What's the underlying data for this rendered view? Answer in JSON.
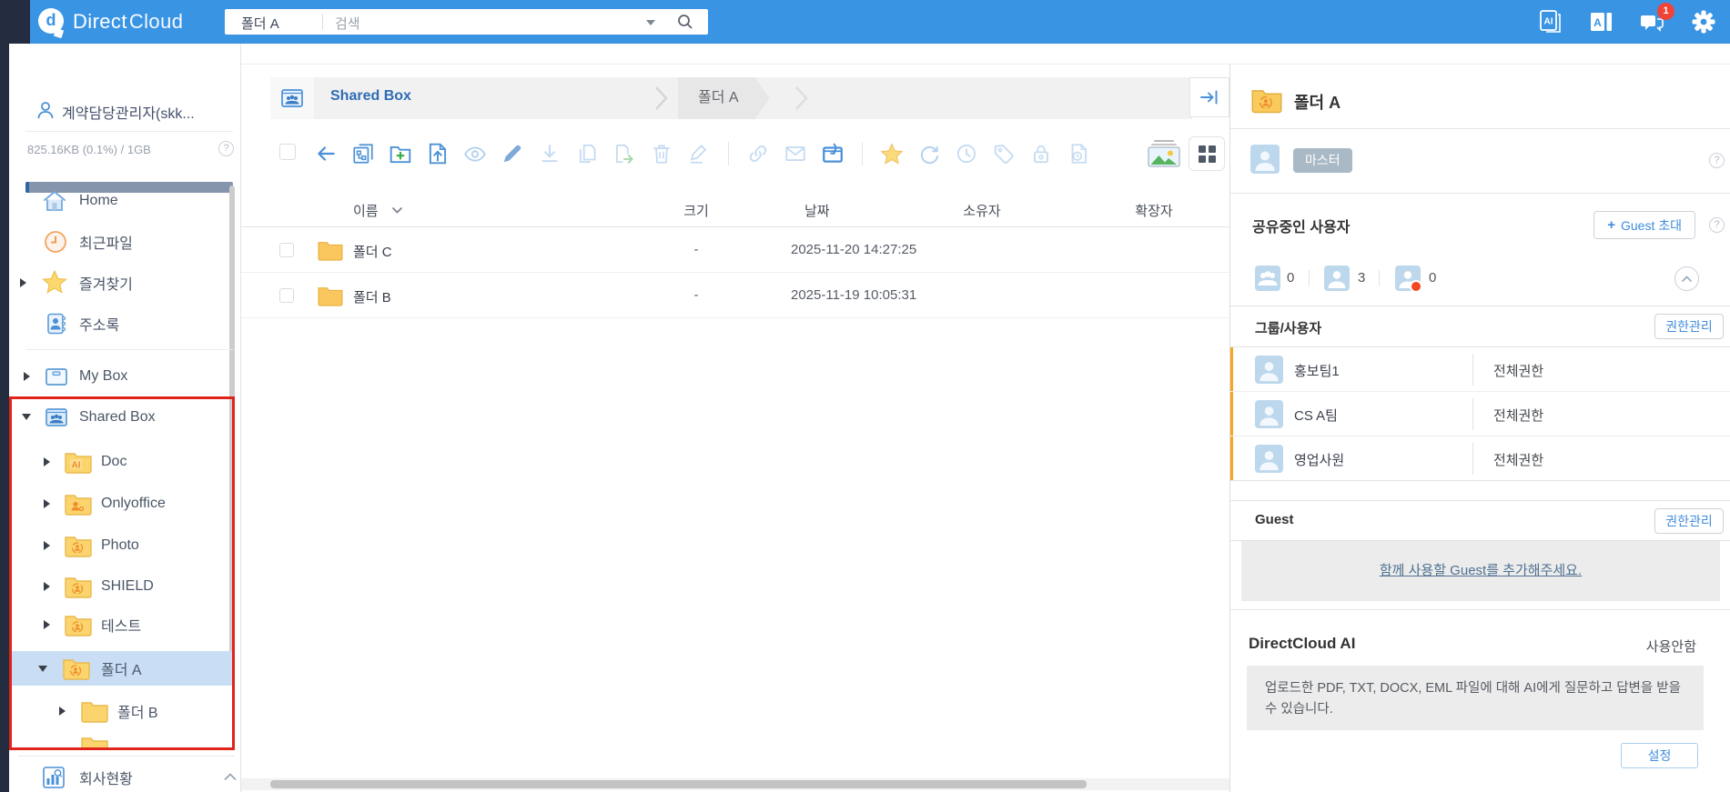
{
  "colors": {
    "topbar_blue": "#3994e4",
    "navy_strip": "#232d3f",
    "accent_blue": "#3f8cdc",
    "selected_row": "#c9def5",
    "highlight_red_box": "#e0241c",
    "notification_red": "#f04438",
    "folder_yellow": "#f9cb5d",
    "permission_bar_orange": "#f6a623"
  },
  "topbar": {
    "brand_direct": "Direct",
    "brand_cloud": "Cloud",
    "search_scope": "폴더 A",
    "search_placeholder": "검색",
    "notification_count": "1"
  },
  "sidebar": {
    "user_name": "계약담당관리자(skk...",
    "storage_usage": "825.16KB (0.1%) / 1GB",
    "nav": [
      {
        "label": "Home"
      },
      {
        "label": "최근파일"
      },
      {
        "label": "즐겨찾기"
      },
      {
        "label": "주소록"
      }
    ],
    "my_box": {
      "label": "My Box"
    },
    "shared_box": {
      "label": "Shared Box",
      "children": [
        {
          "label": "Doc"
        },
        {
          "label": "Onlyoffice"
        },
        {
          "label": "Photo"
        },
        {
          "label": "SHIELD"
        },
        {
          "label": "테스트"
        },
        {
          "label": "폴더 A"
        },
        {
          "label": "폴더 B"
        }
      ]
    },
    "footer": {
      "label": "회사현황"
    }
  },
  "main": {
    "breadcrumb": {
      "root": "Shared Box",
      "current": "폴더 A"
    },
    "toolbar_icons": [
      "back",
      "tree-copy",
      "new-folder",
      "upload",
      "preview",
      "edit",
      "download",
      "copy",
      "move",
      "delete",
      "rename",
      "link",
      "mail",
      "web-collect",
      "favorite",
      "sync",
      "history",
      "tag",
      "lock",
      "file-log",
      "thumbnail-view",
      "grid-view"
    ],
    "table": {
      "columns": [
        "이름",
        "크기",
        "날짜",
        "소유자",
        "확장자"
      ],
      "rows": [
        {
          "name": "폴더 C",
          "size": "-",
          "date": "2025-11-20 14:27:25",
          "owner": "",
          "ext": ""
        },
        {
          "name": "폴더 B",
          "size": "-",
          "date": "2025-11-19 10:05:31",
          "owner": "",
          "ext": ""
        }
      ]
    }
  },
  "panel": {
    "title": "폴더 A",
    "owner_badge": "마스터",
    "sharing": {
      "title": "공유중인 사용자",
      "invite_button": "Guest 초대",
      "group_count": "0",
      "user_count": "3",
      "guest_count": "0"
    },
    "groups": {
      "title": "그룹/사용자",
      "manage_button": "권한관리",
      "rows": [
        {
          "name": "홍보팀1",
          "permission": "전체권한"
        },
        {
          "name": "CS A팀",
          "permission": "전체권한"
        },
        {
          "name": "영업사원",
          "permission": "전체권한"
        }
      ]
    },
    "guest": {
      "title": "Guest",
      "manage_button": "권한관리",
      "empty_link": "함께 사용할 Guest를 추가해주세요."
    },
    "ai": {
      "title": "DirectCloud AI",
      "status": "사용안함",
      "description": "업로드한 PDF, TXT, DOCX, EML 파일에 대해 AI에게 질문하고 답변을 받을 수 있습니다.",
      "settings_button": "설정"
    }
  }
}
